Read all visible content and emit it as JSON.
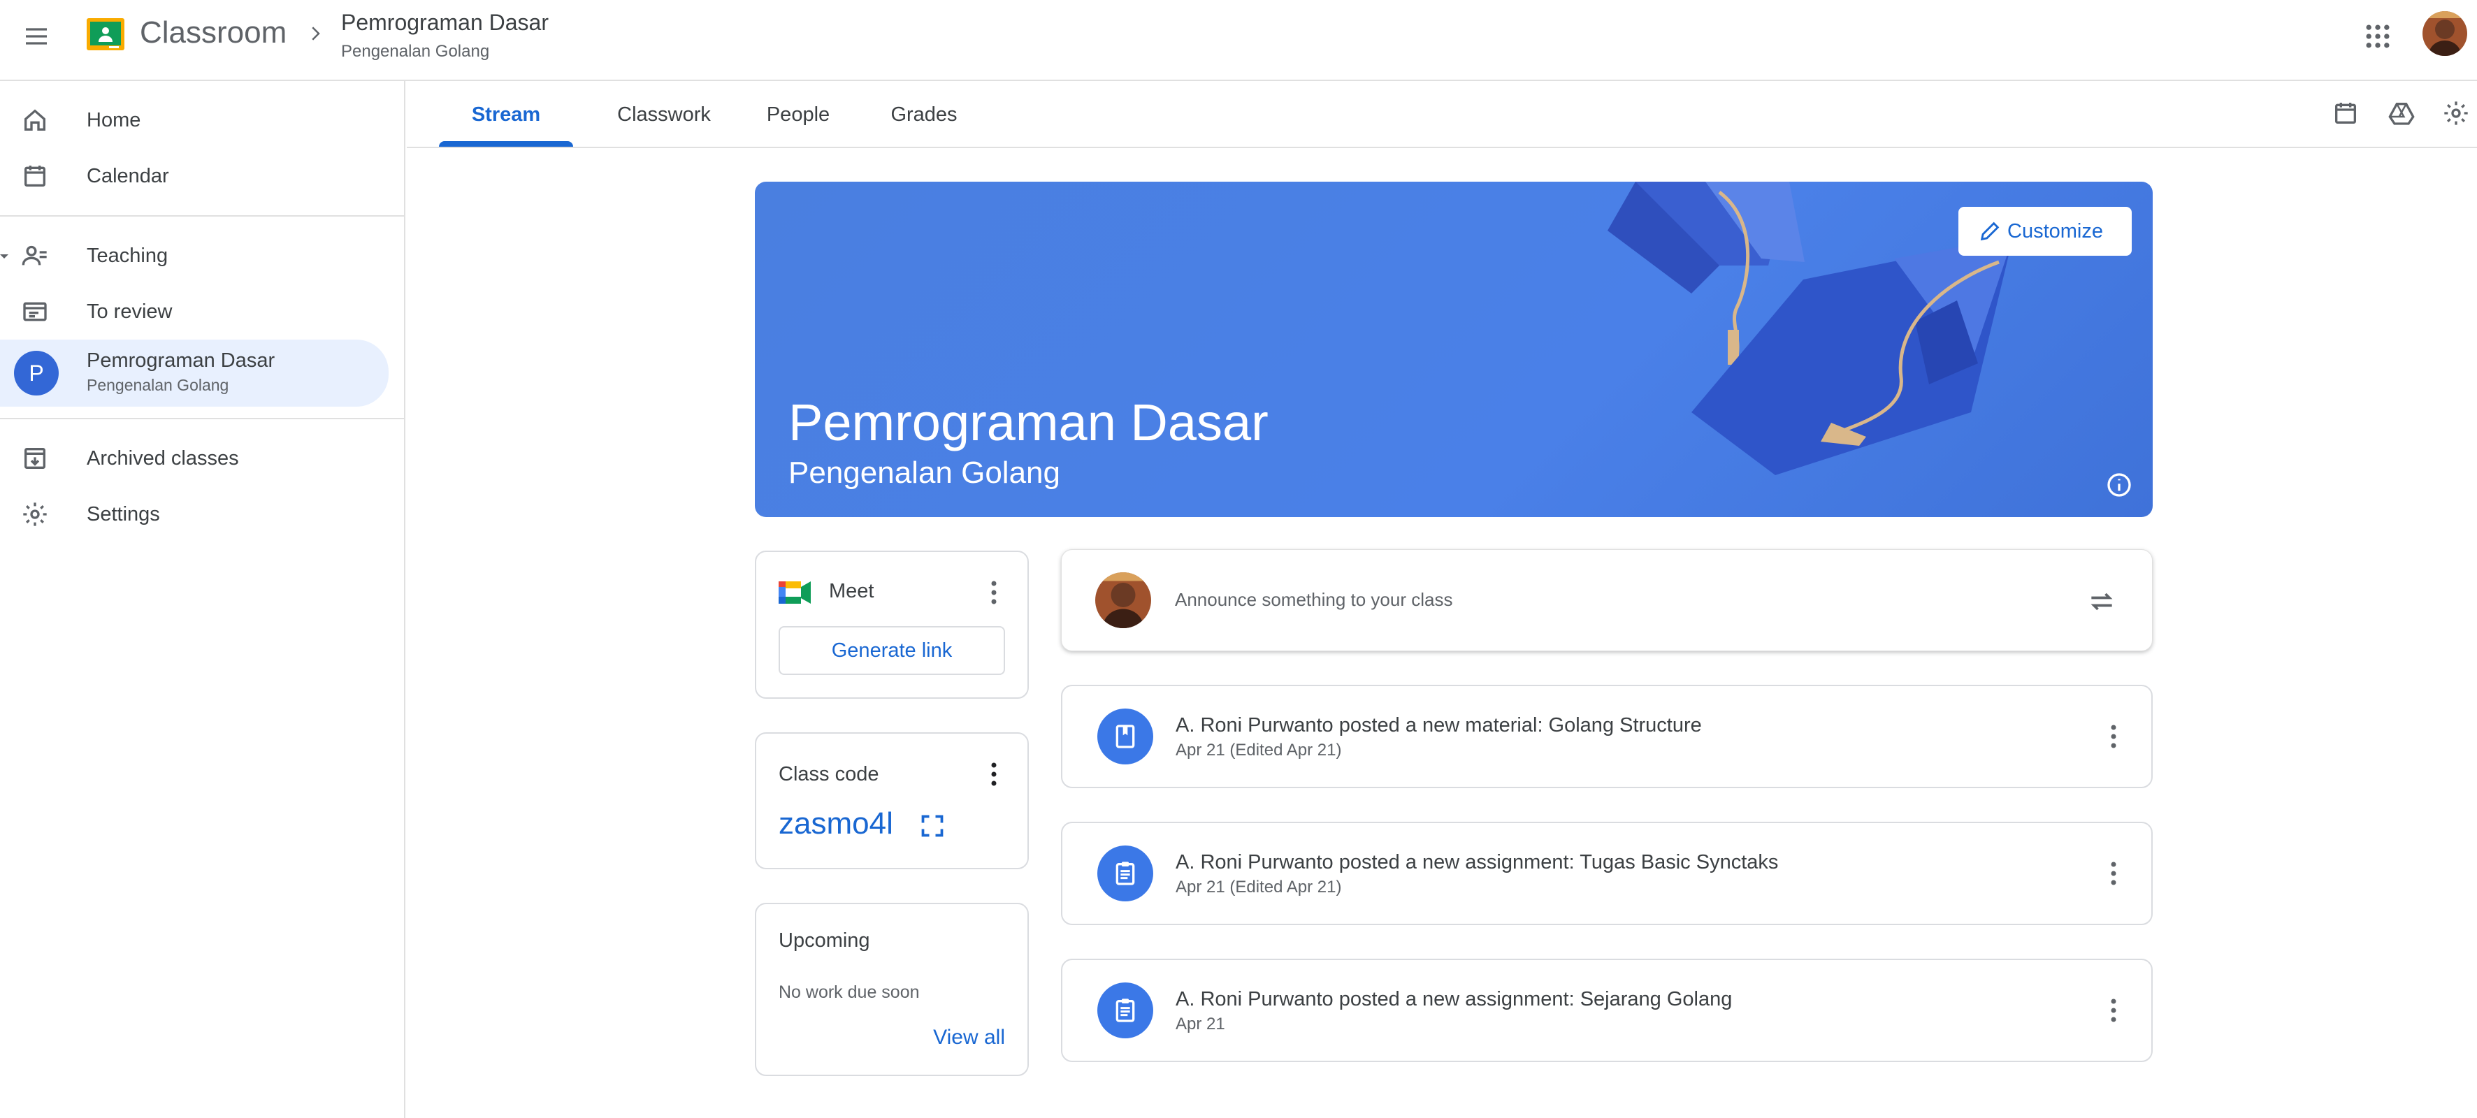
{
  "header": {
    "app_name": "Classroom",
    "class_title": "Pemrograman Dasar",
    "class_subtitle": "Pengenalan Golang"
  },
  "sidebar": {
    "items": [
      {
        "label": "Home",
        "icon": "home-icon"
      },
      {
        "label": "Calendar",
        "icon": "calendar-icon"
      },
      {
        "label": "Teaching",
        "icon": "teaching-icon"
      },
      {
        "label": "To review",
        "icon": "review-icon"
      },
      {
        "label": "Pemrograman Dasar",
        "sub": "Pengenalan Golang",
        "avatar_letter": "P"
      },
      {
        "label": "Archived classes",
        "icon": "archive-icon"
      },
      {
        "label": "Settings",
        "icon": "gear-icon"
      }
    ]
  },
  "tabs": [
    {
      "label": "Stream",
      "active": true
    },
    {
      "label": "Classwork"
    },
    {
      "label": "People"
    },
    {
      "label": "Grades"
    }
  ],
  "banner": {
    "title": "Pemrograman Dasar",
    "subtitle": "Pengenalan Golang",
    "customize_label": "Customize"
  },
  "meet": {
    "label": "Meet",
    "button_label": "Generate link"
  },
  "class_code": {
    "label": "Class code",
    "value": "zasmo4l"
  },
  "upcoming": {
    "label": "Upcoming",
    "empty_text": "No work due soon",
    "link_label": "View all"
  },
  "announce": {
    "placeholder": "Announce something to your class"
  },
  "posts": [
    {
      "title": "A. Roni Purwanto posted a new material: Golang Structure",
      "date": "Apr 21 (Edited Apr 21)",
      "icon": "material-icon"
    },
    {
      "title": "A. Roni Purwanto posted a new assignment: Tugas Basic Synctaks",
      "date": "Apr 21 (Edited Apr 21)",
      "icon": "assignment-icon"
    },
    {
      "title": "A. Roni Purwanto posted a new assignment: Sejarang Golang",
      "date": "Apr 21",
      "icon": "assignment-icon"
    }
  ],
  "colors": {
    "accent": "#1967d2",
    "banner": "#4a80e8",
    "active_nav": "#e8f0fe"
  }
}
